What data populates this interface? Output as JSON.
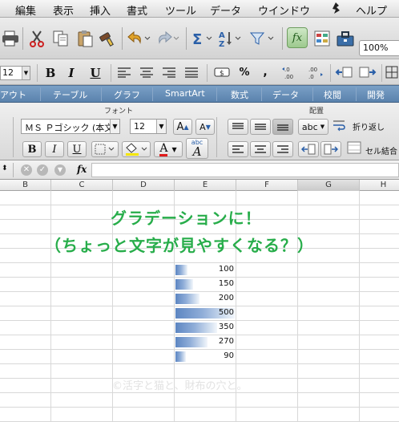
{
  "menu": {
    "items": [
      "編集",
      "表示",
      "挿入",
      "書式",
      "ツール",
      "データ",
      "ウインドウ",
      "ヘルプ"
    ]
  },
  "toolbar": {
    "zoom": "100%",
    "font_size_small": "12",
    "format_buttons": [
      "B",
      "I",
      "U"
    ]
  },
  "ribbon": {
    "tabs": [
      "アウト",
      "テーブル",
      "グラフ",
      "SmartArt",
      "数式",
      "データ",
      "校閲",
      "開発"
    ],
    "font_group_title": "フォント",
    "align_group_title": "配置",
    "font_name": "ＭＳ Ｐゴシック (本文)",
    "font_size": "12",
    "abc_label": "abc",
    "wrap_label": "折り返し",
    "merge_label": "セル結合",
    "bold": "B",
    "italic": "I",
    "underline": "U",
    "grow_font": "A",
    "shrink_font": "A",
    "font_color_glyph": "A",
    "phonetic_glyph": "abc",
    "phonetic_A": "A"
  },
  "formula_bar": {
    "fx": "fx",
    "value": ""
  },
  "columns": [
    "B",
    "C",
    "D",
    "E",
    "F",
    "G",
    "H"
  ],
  "sheet": {
    "headline_1": "グラデーションに！",
    "headline_2": "（ちょっと文字が見やすくなる？）",
    "watermark": "©活字と猫と、財布の穴と。",
    "databar_color_start": "#5d86c2",
    "databar_color_end": "#f2f6fb",
    "headline_color": "#27ad4a",
    "data_values": [
      100,
      150,
      200,
      500,
      350,
      270,
      90
    ],
    "data_max": 500
  }
}
